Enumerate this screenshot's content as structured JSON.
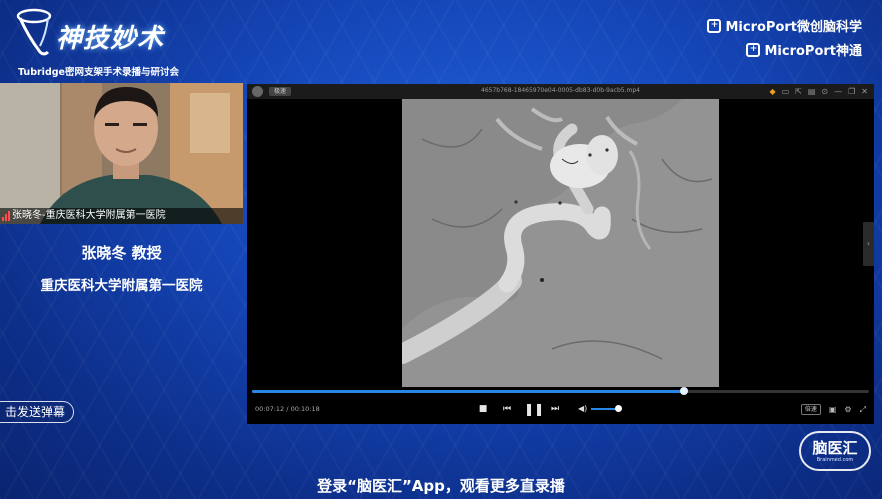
{
  "branding": {
    "title": "神技妙术",
    "subtitle": "Tubridge密网支架手术录播与研讨会",
    "sponsors": [
      "MicroPort微创脑科学",
      "MicroPort神通"
    ]
  },
  "speaker": {
    "caption": "张晓冬-重庆医科大学附属第一医院",
    "name": "张晓冬 教授",
    "affiliation": "重庆医科大学附属第一医院"
  },
  "danmaku": {
    "button_label": "击发送弹幕"
  },
  "player": {
    "titlebar_tag": "极速",
    "file_name": "4657b768-18465970e04-0005-db83-d0b-9acb5.mp4",
    "current_time": "00:07:12",
    "separator": "/",
    "duration": "00:10:18",
    "progress": 0.7,
    "volume": 0.9,
    "speed_label": "倍速",
    "icons": [
      "game-icon",
      "screen-icon",
      "cast-icon",
      "folder-icon",
      "pin-icon",
      "minimize-icon",
      "restore-icon",
      "close-icon",
      "stop-icon",
      "previous-icon",
      "pause-icon",
      "next-icon",
      "volume-icon",
      "fullscreen-icon"
    ]
  },
  "watermark": {
    "logo_text": "脑医汇",
    "logo_sub": "Brainmed.com"
  },
  "footer": {
    "text": "登录“脑医汇”App，观看更多直录播"
  }
}
